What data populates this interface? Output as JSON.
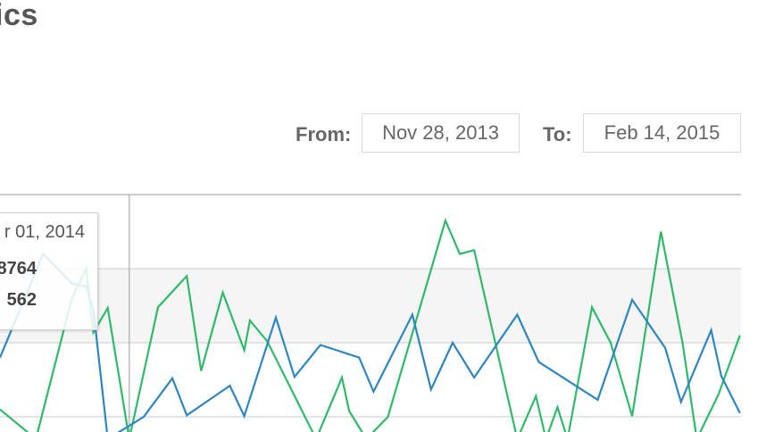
{
  "header": {
    "title": "ics"
  },
  "date_range": {
    "from_label": "From:",
    "from_value": "Nov 28, 2013",
    "to_label": "To:",
    "to_value": "Feb 14, 2015"
  },
  "tooltip": {
    "date": "r 01, 2014",
    "value_1": "8764",
    "value_2": "562"
  },
  "colors": {
    "series_green": "#2dba6b",
    "series_blue": "#2e86c1",
    "band": "#f5f5f5",
    "gridline": "#cccccc"
  },
  "chart_data": {
    "type": "line",
    "grid": true,
    "ylim": [
      0,
      4
    ],
    "xlim": [
      0,
      64
    ],
    "highlight_index": 6,
    "series": [
      {
        "color": "#2dba6b",
        "values": [
          [
            0,
            0.1
          ],
          [
            2.5,
            -0.3
          ],
          [
            5,
            1.6
          ],
          [
            6,
            2.0
          ],
          [
            6.5,
            1.14
          ],
          [
            7.5,
            1.47
          ],
          [
            9,
            -0.3
          ],
          [
            11,
            1.48
          ],
          [
            13,
            1.9
          ],
          [
            14,
            0.62
          ],
          [
            15.5,
            1.68
          ],
          [
            17,
            0.9
          ],
          [
            17.4,
            1.3
          ],
          [
            18.6,
            1.02
          ],
          [
            22,
            -0.3
          ],
          [
            23.8,
            0.53
          ],
          [
            24.3,
            0.08
          ],
          [
            25.5,
            -0.3
          ],
          [
            27,
            0.0
          ],
          [
            31,
            2.65
          ],
          [
            32,
            2.2
          ],
          [
            33,
            2.25
          ],
          [
            36,
            -0.3
          ],
          [
            37.3,
            0.28
          ],
          [
            38,
            -0.3
          ],
          [
            38.8,
            0.13
          ],
          [
            39.5,
            -0.3
          ],
          [
            41.2,
            1.48
          ],
          [
            42.5,
            1.0
          ],
          [
            44,
            0.01
          ],
          [
            46,
            2.5
          ],
          [
            47.5,
            1.0
          ],
          [
            48.5,
            -0.3
          ],
          [
            50,
            0.3
          ],
          [
            51.5,
            1.1
          ]
        ]
      },
      {
        "color": "#2e86c1",
        "values": [
          [
            0,
            0.8
          ],
          [
            3,
            2.2
          ],
          [
            5,
            1.8
          ],
          [
            6,
            1.76
          ],
          [
            6.5,
            1.45
          ],
          [
            7.5,
            -0.3
          ],
          [
            10,
            0.0
          ],
          [
            12,
            0.52
          ],
          [
            13,
            0.02
          ],
          [
            16,
            0.42
          ],
          [
            17,
            0.01
          ],
          [
            19.2,
            1.34
          ],
          [
            20.5,
            0.54
          ],
          [
            22.3,
            0.97
          ],
          [
            25,
            0.8
          ],
          [
            26,
            0.34
          ],
          [
            28.7,
            1.38
          ],
          [
            30,
            0.37
          ],
          [
            31.5,
            1.0
          ],
          [
            33,
            0.53
          ],
          [
            36,
            1.38
          ],
          [
            37.5,
            0.74
          ],
          [
            41.6,
            0.23
          ],
          [
            44,
            1.58
          ],
          [
            46.3,
            0.93
          ],
          [
            47.4,
            0.2
          ],
          [
            49.5,
            1.17
          ],
          [
            50.2,
            0.55
          ],
          [
            51.5,
            0.05
          ]
        ]
      }
    ]
  }
}
